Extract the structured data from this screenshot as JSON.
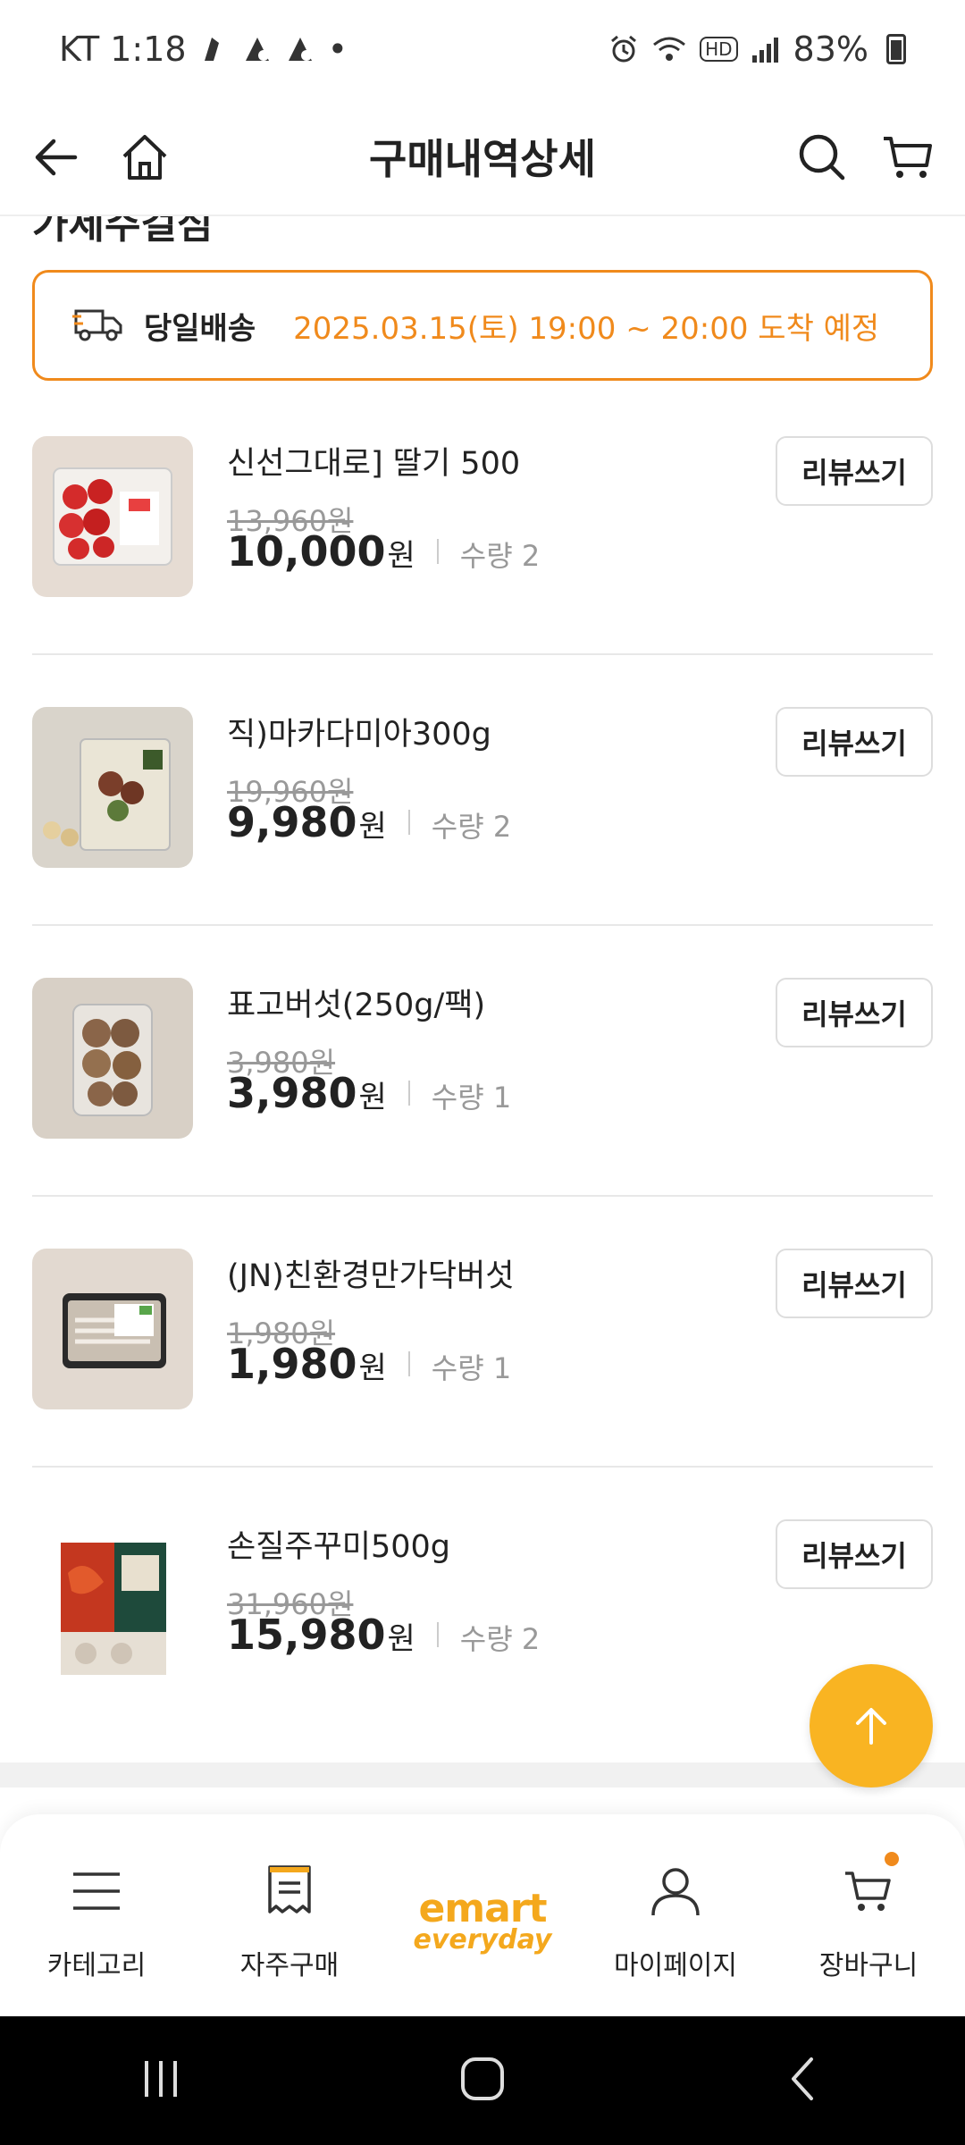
{
  "status_bar": {
    "carrier_time": "KT 1:18",
    "dot": "•",
    "battery": "83%",
    "hd_label": "HD"
  },
  "header": {
    "title": "구매내역상세"
  },
  "section": {
    "cut_title": "가세주걸심"
  },
  "delivery": {
    "label": "당일배송",
    "time": "2025.03.15(토) 19:00 ~ 20:00 도착 예정"
  },
  "items": [
    {
      "name": "신선그대로] 딸기 500",
      "original_price": "13,960원",
      "price": "10,000",
      "won": "원",
      "qty": "수량 2",
      "review": "리뷰쓰기"
    },
    {
      "name": "직)마카다미아300g",
      "original_price": "19,960원",
      "price": "9,980",
      "won": "원",
      "qty": "수량 2",
      "review": "리뷰쓰기"
    },
    {
      "name": "표고버섯(250g/팩)",
      "original_price": "3,980원",
      "price": "3,980",
      "won": "원",
      "qty": "수량 1",
      "review": "리뷰쓰기"
    },
    {
      "name": "(JN)친환경만가닥버섯",
      "original_price": "1,980원",
      "price": "1,980",
      "won": "원",
      "qty": "수량 1",
      "review": "리뷰쓰기"
    },
    {
      "name": "손질주꾸미500g",
      "original_price": "31,960원",
      "price": "15,980",
      "won": "원",
      "qty": "수량 2",
      "review": "리뷰쓰기"
    }
  ],
  "bottom_nav": {
    "category": "카테고리",
    "frequent": "자주구매",
    "logo_top": "emart",
    "logo_bottom": "everyday",
    "mypage": "마이페이지",
    "cart": "장바구니"
  },
  "colors": {
    "accent_orange": "#f08a1c",
    "fab_yellow": "#f9b422"
  }
}
